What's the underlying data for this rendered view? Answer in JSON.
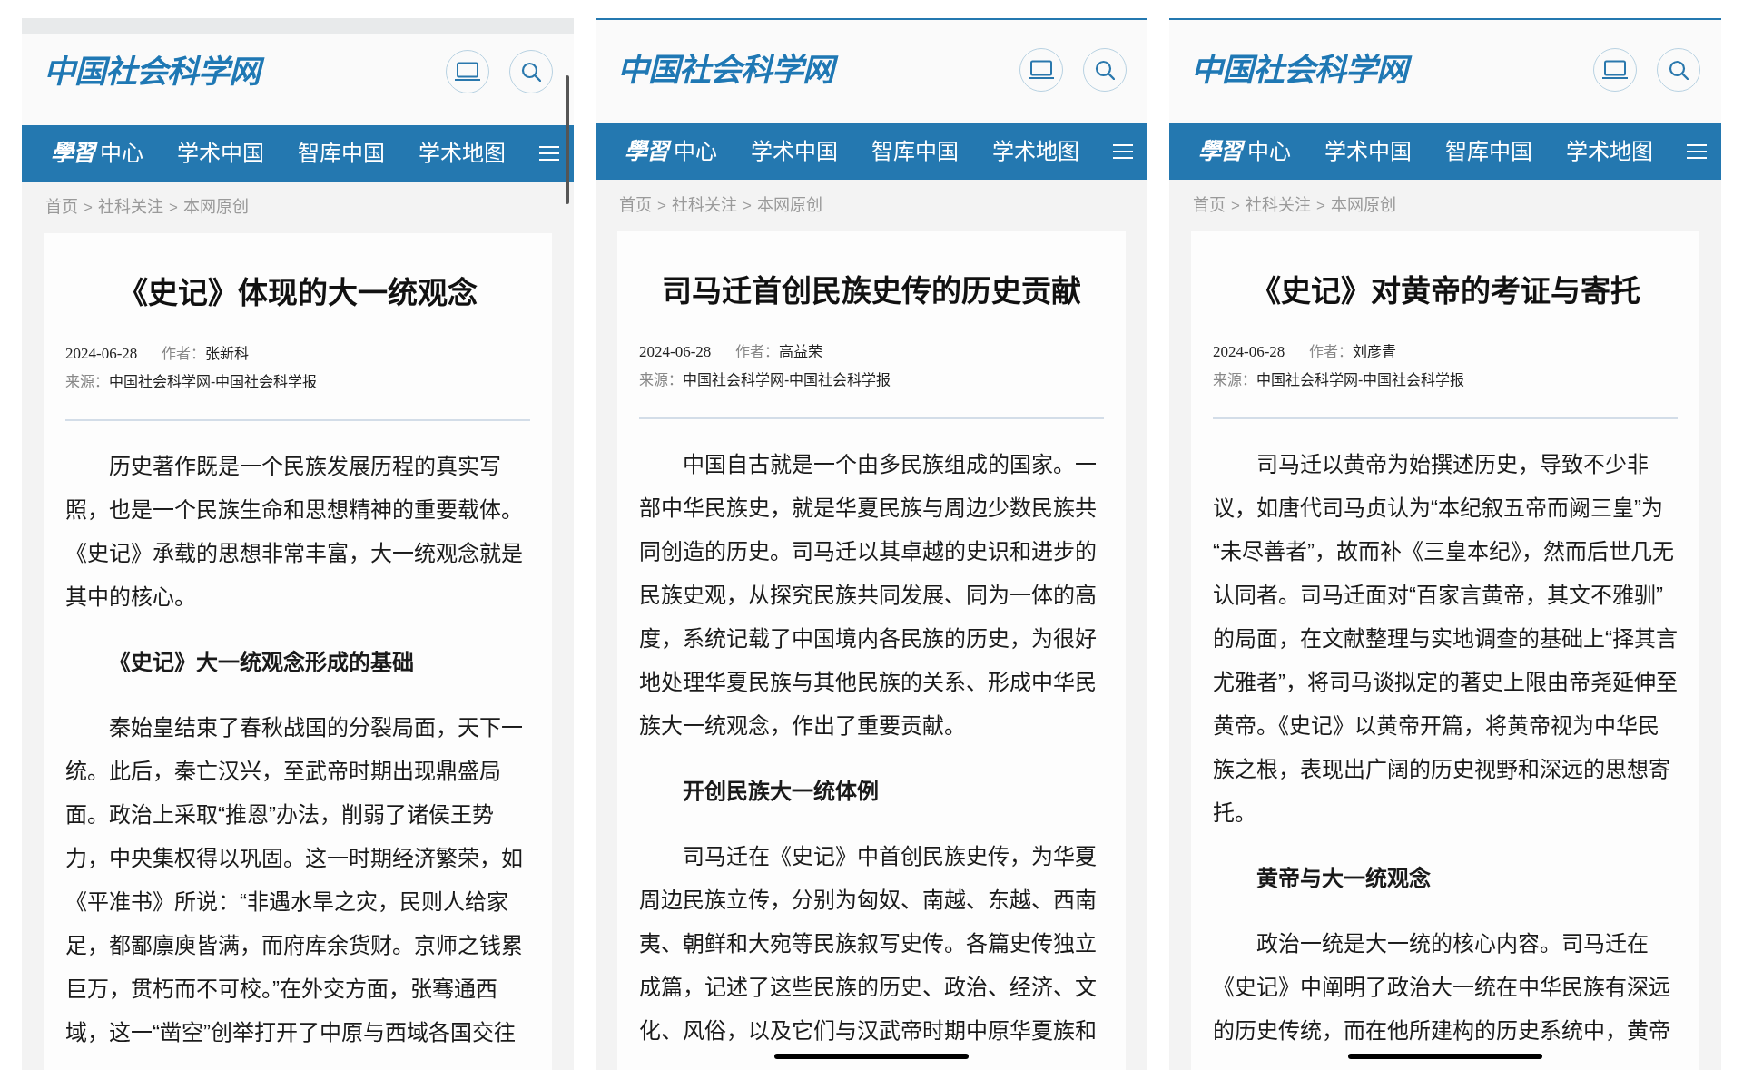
{
  "screens": [
    {
      "top_band": true,
      "top_line": false,
      "scrollbar": true,
      "home_indicator": false,
      "logo": "中国社会科学网",
      "nav": [
        {
          "kind": "brand",
          "script": "學習",
          "label": "中心"
        },
        {
          "kind": "link",
          "label": "学术中国"
        },
        {
          "kind": "link",
          "label": "智库中国"
        },
        {
          "kind": "link",
          "label": "学术地图"
        }
      ],
      "breadcrumb": [
        {
          "kind": "link",
          "text": "首页"
        },
        {
          "kind": "separator",
          "text": ">"
        },
        {
          "kind": "link",
          "text": "社科关注"
        },
        {
          "kind": "separator",
          "text": ">"
        },
        {
          "kind": "link",
          "text": "本网原创"
        }
      ],
      "article": {
        "title": "《史记》体现的大一统观念",
        "date": "2024-06-28",
        "author_label": "作者：",
        "author": "张新科",
        "source_label": "来源：",
        "source": "中国社会科学网-中国社会科学报",
        "body": [
          {
            "kind": "paragraph",
            "text": "历史著作既是一个民族发展历程的真实写照，也是一个民族生命和思想精神的重要载体。《史记》承载的思想非常丰富，大一统观念就是其中的核心。"
          },
          {
            "kind": "heading",
            "text": "《史记》大一统观念形成的基础"
          },
          {
            "kind": "paragraph",
            "text": "秦始皇结束了春秋战国的分裂局面，天下一统。此后，秦亡汉兴，至武帝时期出现鼎盛局面。政治上采取“推恩”办法，削弱了诸侯王势力，中央集权得以巩固。这一时期经济繁荣，如《平准书》所说：“非遇水旱之灾，民则人给家足，都鄙廪庾皆满，而府库余货财。京师之钱累巨万，贯朽而不可校。”在外交方面，张骞通西域，这一“凿空”创举打开了中原与西域各国交往"
          }
        ]
      }
    },
    {
      "top_band": false,
      "top_line": true,
      "scrollbar": false,
      "home_indicator": true,
      "logo": "中国社会科学网",
      "nav": [
        {
          "kind": "brand",
          "script": "學習",
          "label": "中心"
        },
        {
          "kind": "link",
          "label": "学术中国"
        },
        {
          "kind": "link",
          "label": "智库中国"
        },
        {
          "kind": "link",
          "label": "学术地图"
        }
      ],
      "breadcrumb": [
        {
          "kind": "link",
          "text": "首页"
        },
        {
          "kind": "separator",
          "text": ">"
        },
        {
          "kind": "link",
          "text": "社科关注"
        },
        {
          "kind": "separator",
          "text": ">"
        },
        {
          "kind": "link",
          "text": "本网原创"
        }
      ],
      "article": {
        "title": "司马迁首创民族史传的历史贡献",
        "date": "2024-06-28",
        "author_label": "作者：",
        "author": "高益荣",
        "source_label": "来源：",
        "source": "中国社会科学网-中国社会科学报",
        "body": [
          {
            "kind": "paragraph",
            "text": "中国自古就是一个由多民族组成的国家。一部中华民族史，就是华夏民族与周边少数民族共同创造的历史。司马迁以其卓越的史识和进步的民族史观，从探究民族共同发展、同为一体的高度，系统记载了中国境内各民族的历史，为很好地处理华夏民族与其他民族的关系、形成中华民族大一统观念，作出了重要贡献。"
          },
          {
            "kind": "heading",
            "text": "开创民族大一统体例"
          },
          {
            "kind": "paragraph",
            "text": "司马迁在《史记》中首创民族史传，为华夏周边民族立传，分别为匈奴、南越、东越、西南夷、朝鲜和大宛等民族叙写史传。各篇史传独立成篇，记述了这些民族的历史、政治、经济、文化、风俗，以及它们与汉武帝时期中原华夏族和"
          }
        ]
      }
    },
    {
      "top_band": false,
      "top_line": true,
      "scrollbar": false,
      "home_indicator": true,
      "logo": "中国社会科学网",
      "nav": [
        {
          "kind": "brand",
          "script": "學習",
          "label": "中心"
        },
        {
          "kind": "link",
          "label": "学术中国"
        },
        {
          "kind": "link",
          "label": "智库中国"
        },
        {
          "kind": "link",
          "label": "学术地图"
        }
      ],
      "breadcrumb": [
        {
          "kind": "link",
          "text": "首页"
        },
        {
          "kind": "separator",
          "text": ">"
        },
        {
          "kind": "link",
          "text": "社科关注"
        },
        {
          "kind": "separator",
          "text": ">"
        },
        {
          "kind": "link",
          "text": "本网原创"
        }
      ],
      "article": {
        "title": "《史记》对黄帝的考证与寄托",
        "date": "2024-06-28",
        "author_label": "作者：",
        "author": "刘彦青",
        "source_label": "来源：",
        "source": "中国社会科学网-中国社会科学报",
        "body": [
          {
            "kind": "paragraph",
            "text": "司马迁以黄帝为始撰述历史，导致不少非议，如唐代司马贞认为“本纪叙五帝而阙三皇”为“未尽善者”，故而补《三皇本纪》，然而后世几无认同者。司马迁面对“百家言黄帝，其文不雅驯”的局面，在文献整理与实地调查的基础上“择其言尤雅者”，将司马谈拟定的著史上限由帝尧延伸至黄帝。《史记》以黄帝开篇，将黄帝视为中华民族之根，表现出广阔的历史视野和深远的思想寄托。"
          },
          {
            "kind": "heading",
            "text": "黄帝与大一统观念"
          },
          {
            "kind": "paragraph",
            "text": "政治一统是大一统的核心内容。司马迁在《史记》中阐明了政治大一统在中华民族有深远的历史传统，而在他所建构的历史系统中，黄帝"
          }
        ]
      }
    }
  ]
}
